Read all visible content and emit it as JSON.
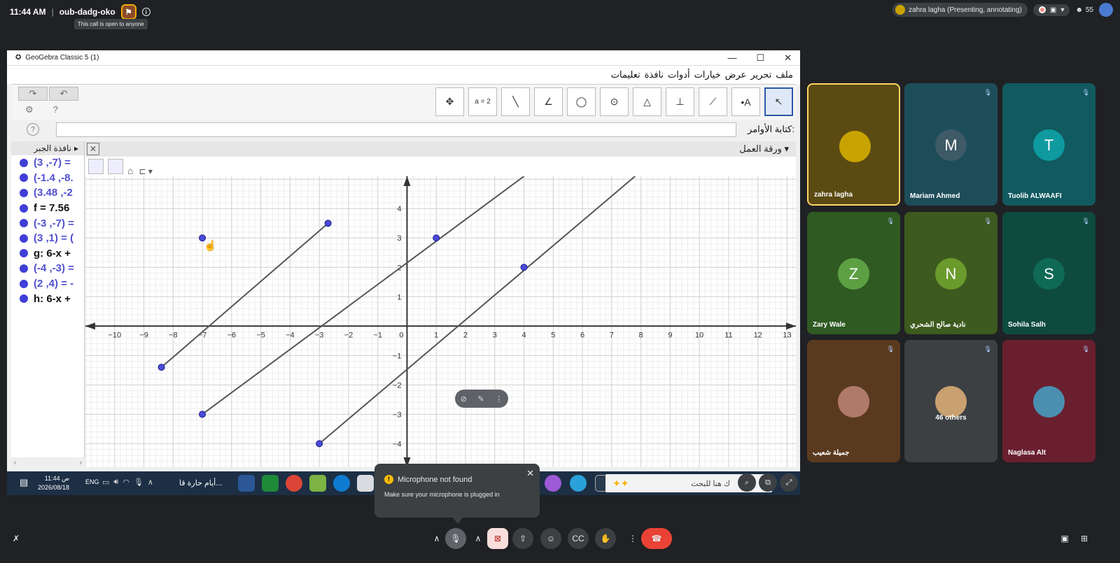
{
  "topbar": {
    "time": "11:44 AM",
    "separator": "|",
    "meeting_code": "oub-dadg-oko",
    "tooltip": "This call is open to anyone",
    "presenter_chip": "zahra lagha (Presenting, annotating)",
    "people_count": "55"
  },
  "window": {
    "title": "GeoGebra Classic 5 (1)",
    "menu": [
      "ملف",
      "تحرير",
      "عرض",
      "خيارات",
      "أدوات",
      "نافذة",
      "تعليمات"
    ],
    "command_label": "كتابة الأوامر:",
    "algebra_title": "نافذة الجبر",
    "graphics_title": "ورقة العمل",
    "tool_a2": "a = 2",
    "algebra_rows": [
      {
        "text": "(3 ,-7) =",
        "style": "blue"
      },
      {
        "text": "(-1.4 ,-8.",
        "style": "blue"
      },
      {
        "text": "(3.48 ,-2",
        "style": "blue"
      },
      {
        "text": "f = 7.56",
        "style": "black"
      },
      {
        "text": "(-3 ,-7) =",
        "style": "blue"
      },
      {
        "text": "(3 ,1) = (",
        "style": "blue"
      },
      {
        "text": "g: 6-x +",
        "style": "black"
      },
      {
        "text": "(-4 ,-3) =",
        "style": "blue"
      },
      {
        "text": "(2 ,4) = -",
        "style": "blue"
      },
      {
        "text": "h: 6-x +",
        "style": "black"
      }
    ]
  },
  "chart_data": {
    "type": "scatter",
    "x_ticks": [
      "−10",
      "−9",
      "−8",
      "−7",
      "−6",
      "−5",
      "−4",
      "−3",
      "−2",
      "−1",
      "0",
      "1",
      "2",
      "3",
      "4",
      "5",
      "6",
      "7",
      "8",
      "9",
      "10",
      "11",
      "12",
      "13"
    ],
    "y_ticks": [
      "4",
      "3",
      "2",
      "1",
      "−1",
      "−2",
      "−3",
      "−4"
    ],
    "xlim": [
      -11,
      13.3
    ],
    "ylim": [
      -4.8,
      5.1
    ],
    "grid": true,
    "points": [
      {
        "x": -7,
        "y": 3
      },
      {
        "x": -2.7,
        "y": 3.5
      },
      {
        "x": -8.4,
        "y": -1.4
      },
      {
        "x": 1,
        "y": 3
      },
      {
        "x": -7,
        "y": -3
      },
      {
        "x": 4,
        "y": 2
      },
      {
        "x": -3,
        "y": -4
      }
    ],
    "segments": [
      {
        "from": [
          -8.4,
          -1.4
        ],
        "to": [
          -2.7,
          3.5
        ]
      },
      {
        "from": [
          -7,
          -3
        ],
        "to": [
          4,
          5.1
        ]
      },
      {
        "from": [
          -3,
          -4
        ],
        "to": [
          7.8,
          5.1
        ]
      }
    ]
  },
  "taskbar": {
    "time": "11:44 ص",
    "date": "2026/08/18",
    "lang": "ENG",
    "news": "أيام حارة قا...",
    "search_placeholder": "ك هنا للبحث"
  },
  "mic_popup": {
    "title": "Microphone not found",
    "body": "Make sure your microphone is plugged in"
  },
  "participants": [
    {
      "name": "zahra lagha",
      "initial": "",
      "bg": "#5b4a12",
      "avatar_bg": "#c8a300",
      "active": true
    },
    {
      "name": "Mariam Ahmed",
      "initial": "M",
      "bg": "#1e4d5a",
      "avatar_bg": "#3d5a66",
      "active": false
    },
    {
      "name": "Tuolib ALWAAFI",
      "initial": "T",
      "bg": "#115a60",
      "avatar_bg": "#0f9aa0",
      "active": false
    },
    {
      "name": "Zary Wale",
      "initial": "Z",
      "bg": "#2f5a22",
      "avatar_bg": "#5ca043",
      "active": false
    },
    {
      "name": "نادية صالح الشحري",
      "initial": "N",
      "bg": "#3d5a1f",
      "avatar_bg": "#6a9a2c",
      "active": false
    },
    {
      "name": "Sohila Salh",
      "initial": "S",
      "bg": "#0f4a3e",
      "avatar_bg": "#0f6a55",
      "active": false
    },
    {
      "name": "جميلة شعيب",
      "initial": "",
      "bg": "#5a3a1f",
      "avatar_bg": "#b07a6a",
      "active": false
    },
    {
      "name": "46 others",
      "initial": "",
      "bg": "#3c4043",
      "avatar_bg": "#c9a070",
      "active": false
    },
    {
      "name": "Naglasa Alt",
      "initial": "",
      "bg": "#6a1f2e",
      "avatar_bg": "#4a8fb0",
      "active": false
    }
  ]
}
